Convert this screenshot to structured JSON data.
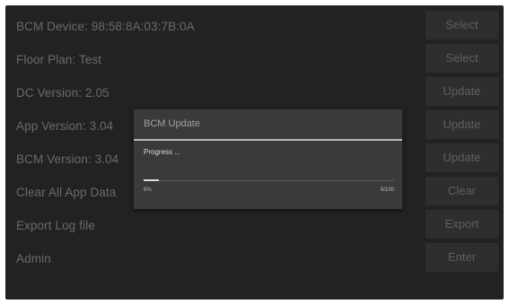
{
  "settings": {
    "rows": [
      {
        "label": "BCM Device: 98:58:8A:03:7B:0A",
        "button": "Select"
      },
      {
        "label": "Floor Plan:  Test",
        "button": "Select"
      },
      {
        "label": "DC Version:  2.05",
        "button": "Update"
      },
      {
        "label": "App Version:  3.04",
        "button": "Update"
      },
      {
        "label": "BCM Version:  3.04",
        "button": "Update"
      },
      {
        "label": "Clear All App Data",
        "button": "Clear"
      },
      {
        "label": "Export Log file",
        "button": "Export"
      },
      {
        "label": "Admin",
        "button": "Enter"
      }
    ]
  },
  "dialog": {
    "title": "BCM Update",
    "message": "Progress ...",
    "percent_label": "6%",
    "count_label": "6/100",
    "progress_fraction": 0.06
  },
  "colors": {
    "background": "#222222",
    "button_bg": "#2e2e2e",
    "dialog_bg": "#3a3a3a",
    "dialog_divider": "#b9b9b9"
  }
}
